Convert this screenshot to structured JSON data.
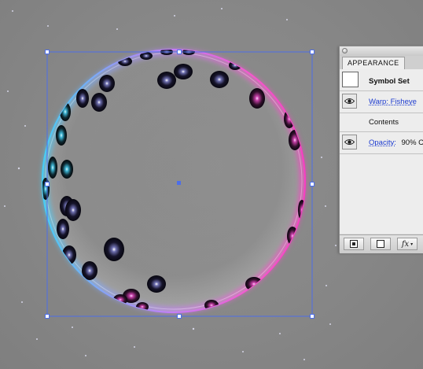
{
  "panel": {
    "tab_label": "APPEARANCE",
    "rows": [
      {
        "label": "Symbol Set",
        "type": "title"
      },
      {
        "label": "Warp: Fisheye",
        "type": "effect"
      },
      {
        "label": "Contents",
        "type": "plain"
      },
      {
        "opacity_label": "Opacity:",
        "opacity_value": "90% C",
        "type": "attribute"
      }
    ],
    "footer": {
      "fx_label": "fx"
    }
  },
  "colors": {
    "canvas": "#878787",
    "selection": "#4d6ee8",
    "link": "#1c3bd0",
    "glow_left": "#39c6ff",
    "glow_right": "#ff39c9"
  },
  "icons": [
    "eye-icon",
    "new-art-icon",
    "clear-appearance-icon",
    "fx-icon",
    "close-icon"
  ]
}
